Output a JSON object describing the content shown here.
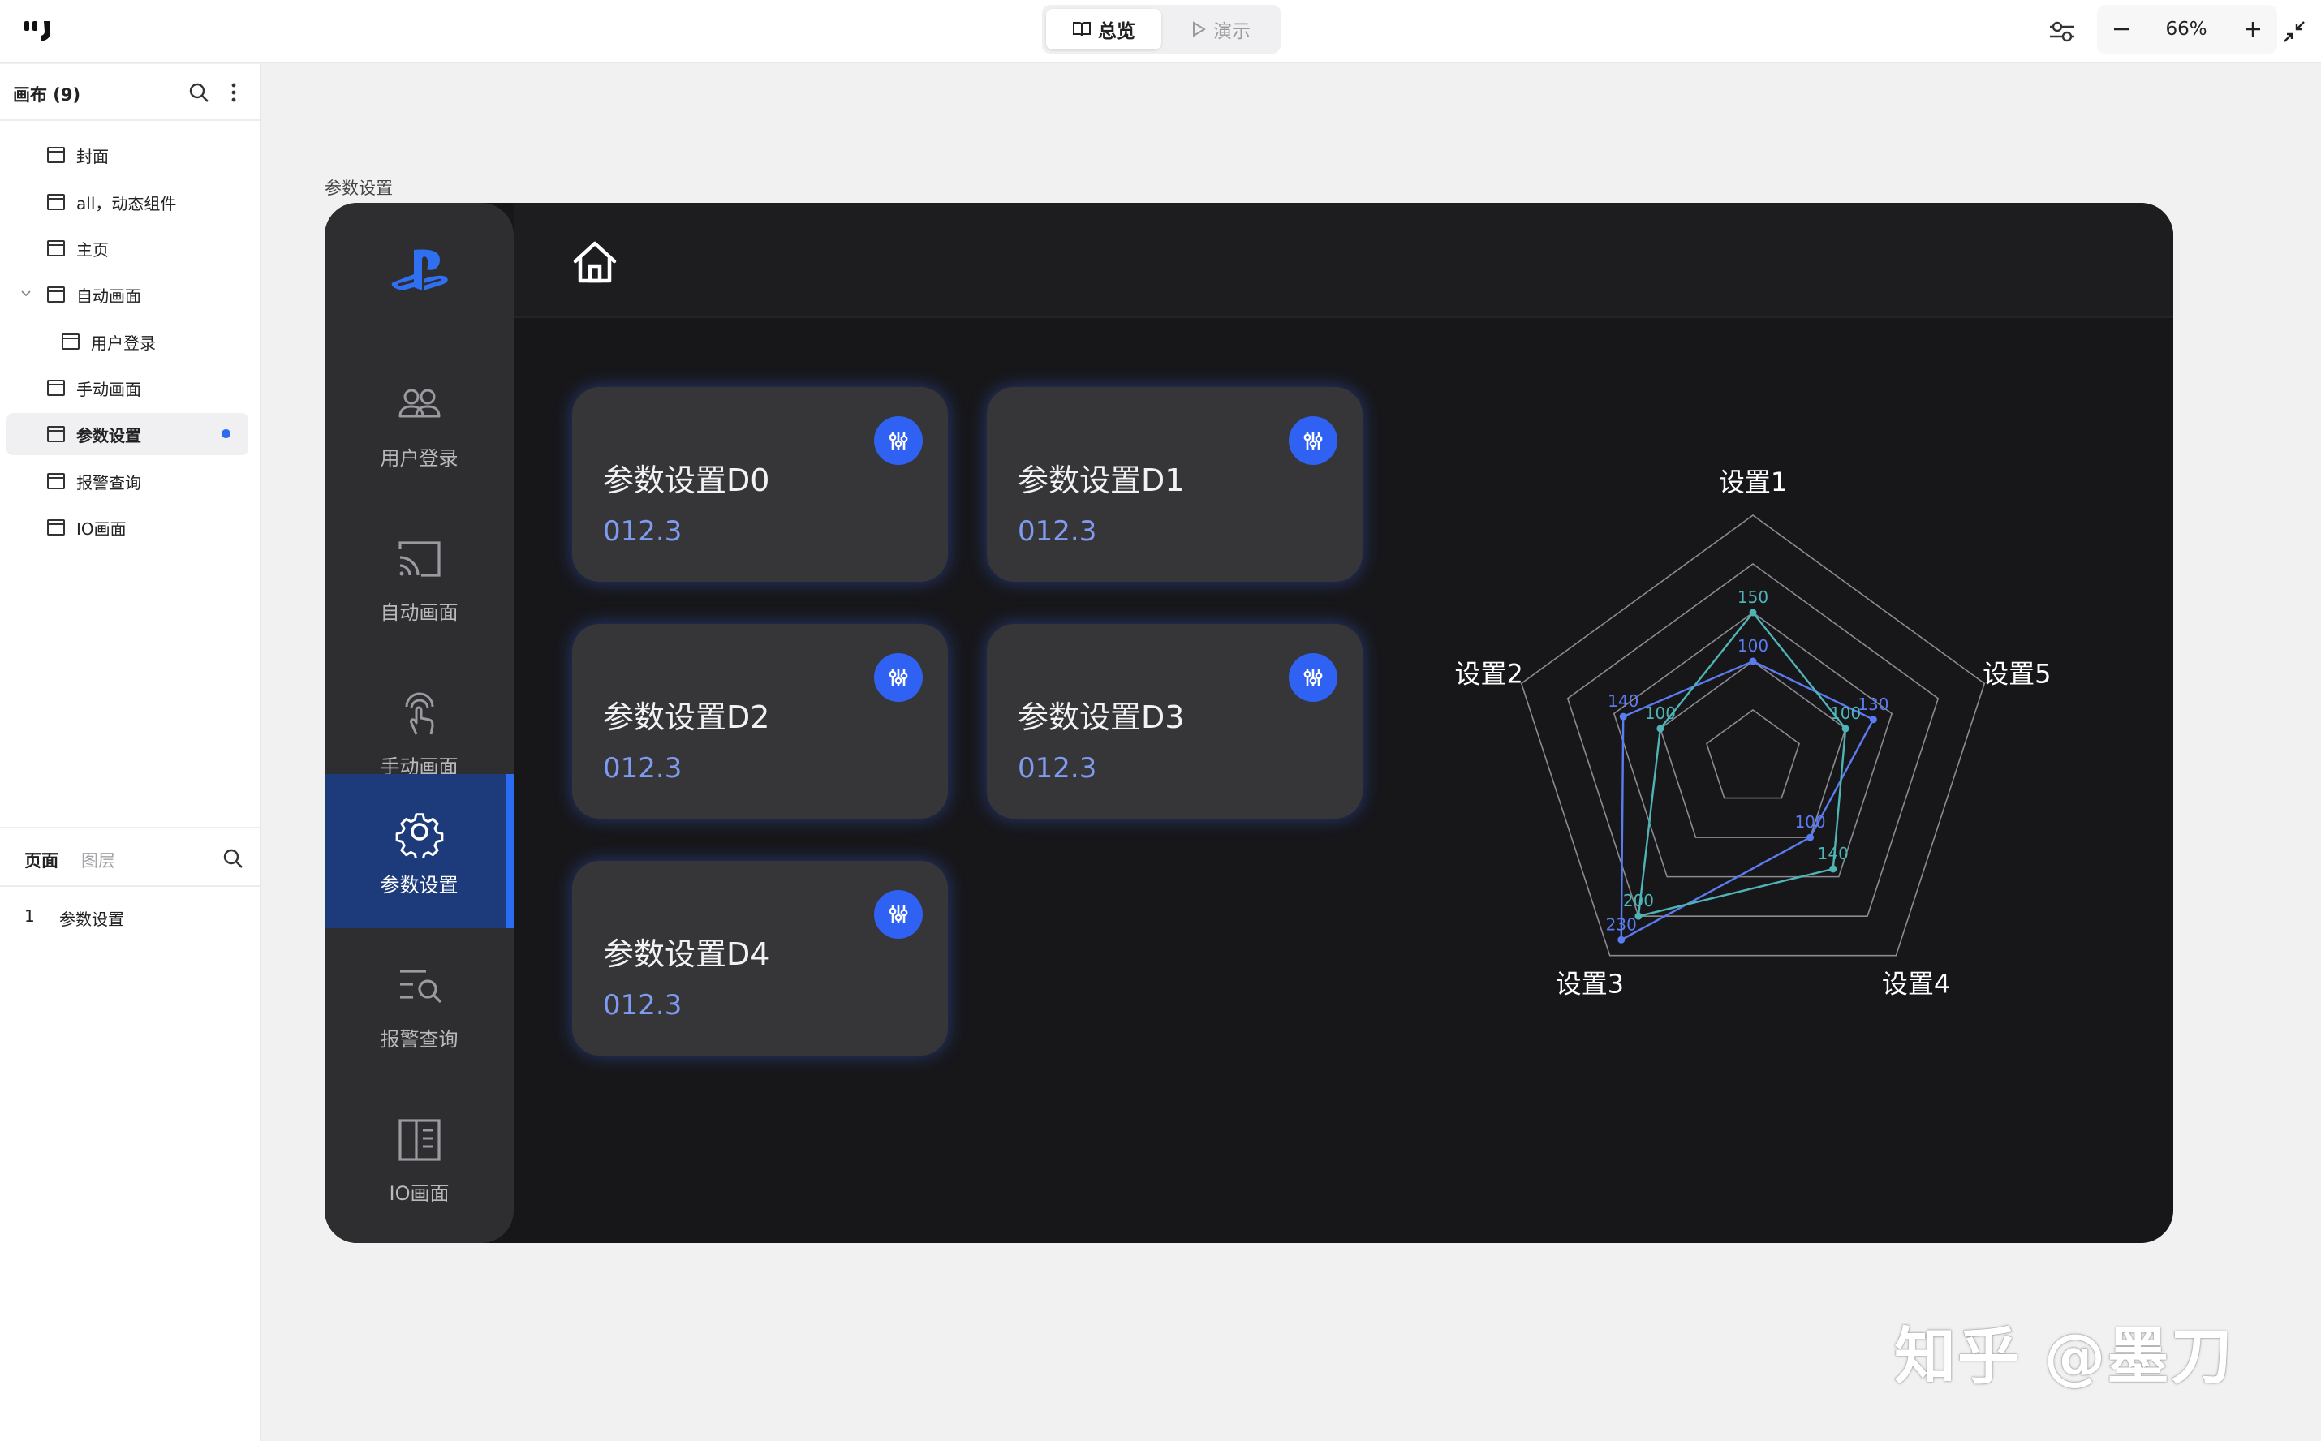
{
  "toolbar": {
    "overview_label": "总览",
    "present_label": "演示",
    "zoom": "66%"
  },
  "left_panel": {
    "title": "画布 (9)",
    "pages": [
      {
        "label": "封面"
      },
      {
        "label": "all，动态组件"
      },
      {
        "label": "主页"
      },
      {
        "label": "自动画面"
      },
      {
        "label": "用户登录"
      },
      {
        "label": "手动画面"
      },
      {
        "label": "参数设置"
      },
      {
        "label": "报警查询"
      },
      {
        "label": "IO画面"
      }
    ],
    "tabs": {
      "page": "页面",
      "layer": "图层"
    },
    "layer_row": {
      "num": "1",
      "name": "参数设置"
    }
  },
  "canvas": {
    "frame_label": "参数设置",
    "nav": [
      {
        "label": "用户登录",
        "icon": "users-icon"
      },
      {
        "label": "自动画面",
        "icon": "cast-icon"
      },
      {
        "label": "手动画面",
        "icon": "touch-icon"
      },
      {
        "label": "参数设置",
        "icon": "gear-icon"
      },
      {
        "label": "报警查询",
        "icon": "list-search-icon"
      },
      {
        "label": "IO画面",
        "icon": "io-panel-icon"
      }
    ],
    "cards": [
      {
        "title": "参数设置D0",
        "value": "012.3"
      },
      {
        "title": "参数设置D1",
        "value": "012.3"
      },
      {
        "title": "参数设置D2",
        "value": "012.3"
      },
      {
        "title": "参数设置D3",
        "value": "012.3"
      },
      {
        "title": "参数设置D4",
        "value": "012.3"
      }
    ]
  },
  "chart_data": {
    "type": "radar",
    "axes": [
      "设置1",
      "设置5",
      "设置4",
      "设置3",
      "设置2"
    ],
    "series": [
      {
        "color": "#5b7bf0",
        "values": [
          100,
          130,
          100,
          230,
          140
        ]
      },
      {
        "color": "#4fb4b6",
        "values": [
          150,
          100,
          140,
          200,
          100
        ]
      }
    ],
    "rings": 5
  },
  "watermark": "知乎 @墨刀",
  "colors": {
    "accent": "#2f62f3",
    "active_nav": "#1d3a7a",
    "value_text": "#7f9bf0"
  }
}
